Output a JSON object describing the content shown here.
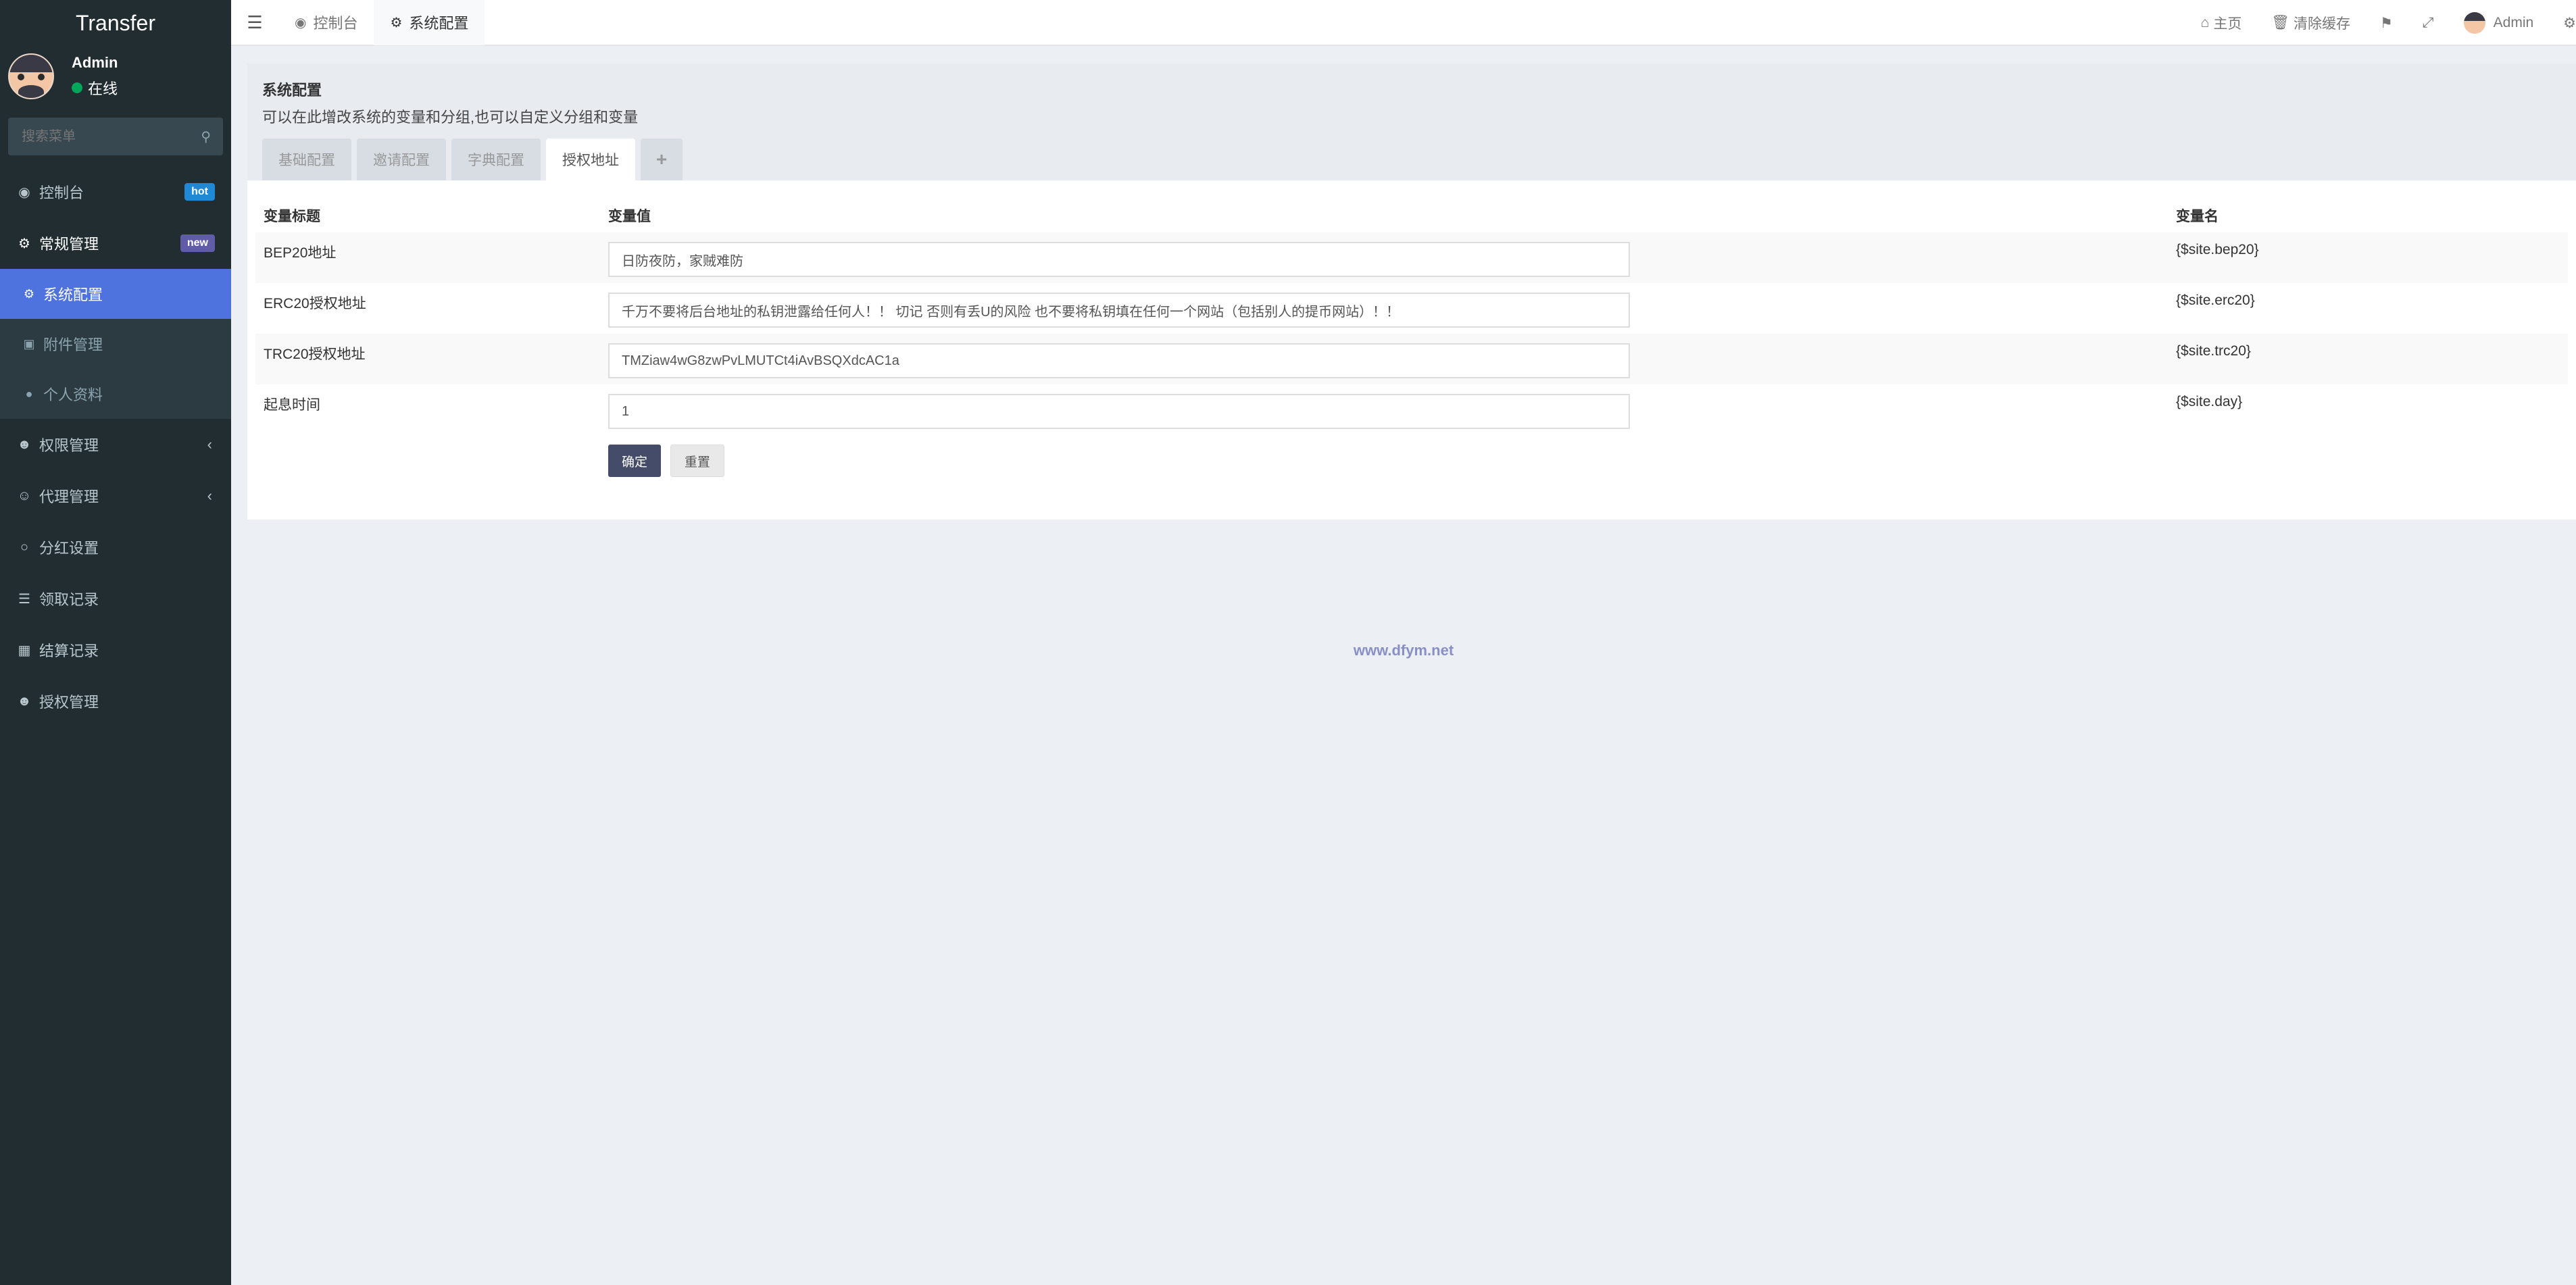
{
  "brand": "Transfer",
  "user": {
    "name": "Admin",
    "status": "在线"
  },
  "search": {
    "placeholder": "搜索菜单"
  },
  "sidebar": {
    "items": [
      {
        "label": "控制台",
        "icon": "dashboard-icon",
        "badge": "hot"
      },
      {
        "label": "常规管理",
        "icon": "cogs-icon",
        "badge": "new"
      },
      {
        "label": "系统配置",
        "icon": "gear-icon"
      },
      {
        "label": "附件管理",
        "icon": "file-image-icon"
      },
      {
        "label": "个人资料",
        "icon": "user-icon"
      },
      {
        "label": "权限管理",
        "icon": "group-icon"
      },
      {
        "label": "代理管理",
        "icon": "user-circle-icon"
      },
      {
        "label": "分红设置",
        "icon": "circle-icon"
      },
      {
        "label": "领取记录",
        "icon": "list-icon"
      },
      {
        "label": "结算记录",
        "icon": "list-alt-icon"
      },
      {
        "label": "授权管理",
        "icon": "group-icon"
      }
    ]
  },
  "navbar": {
    "tabs": [
      {
        "label": "控制台",
        "icon": "dashboard-icon"
      },
      {
        "label": "系统配置",
        "icon": "gear-icon"
      }
    ],
    "right": {
      "home": "主页",
      "clear_cache": "清除缓存",
      "user": "Admin"
    }
  },
  "panel": {
    "title": "系统配置",
    "description": "可以在此增改系统的变量和分组,也可以自定义分组和变量",
    "tabs": [
      "基础配置",
      "邀请配置",
      "字典配置",
      "授权地址",
      "+"
    ],
    "table": {
      "headers": [
        "变量标题",
        "变量值",
        "变量名"
      ],
      "rows": [
        {
          "title": "BEP20地址",
          "value": "日防夜防，家贼难防",
          "name": "{$site.bep20}"
        },
        {
          "title": "ERC20授权地址",
          "value": "千万不要将后台地址的私钥泄露给任何人！！ 切记 否则有丢U的风险 也不要将私钥填在任何一个网站（包括别人的提币网站）！！",
          "name": "{$site.erc20}"
        },
        {
          "title": "TRC20授权地址",
          "value": "TMZiaw4wG8zwPvLMUTCt4iAvBSQXdcAC1a",
          "name": "{$site.trc20}"
        },
        {
          "title": "起息时间",
          "value": "1",
          "name": "{$site.day}"
        }
      ]
    },
    "buttons": {
      "confirm": "确定",
      "reset": "重置"
    }
  },
  "watermark": "www.dfym.net"
}
